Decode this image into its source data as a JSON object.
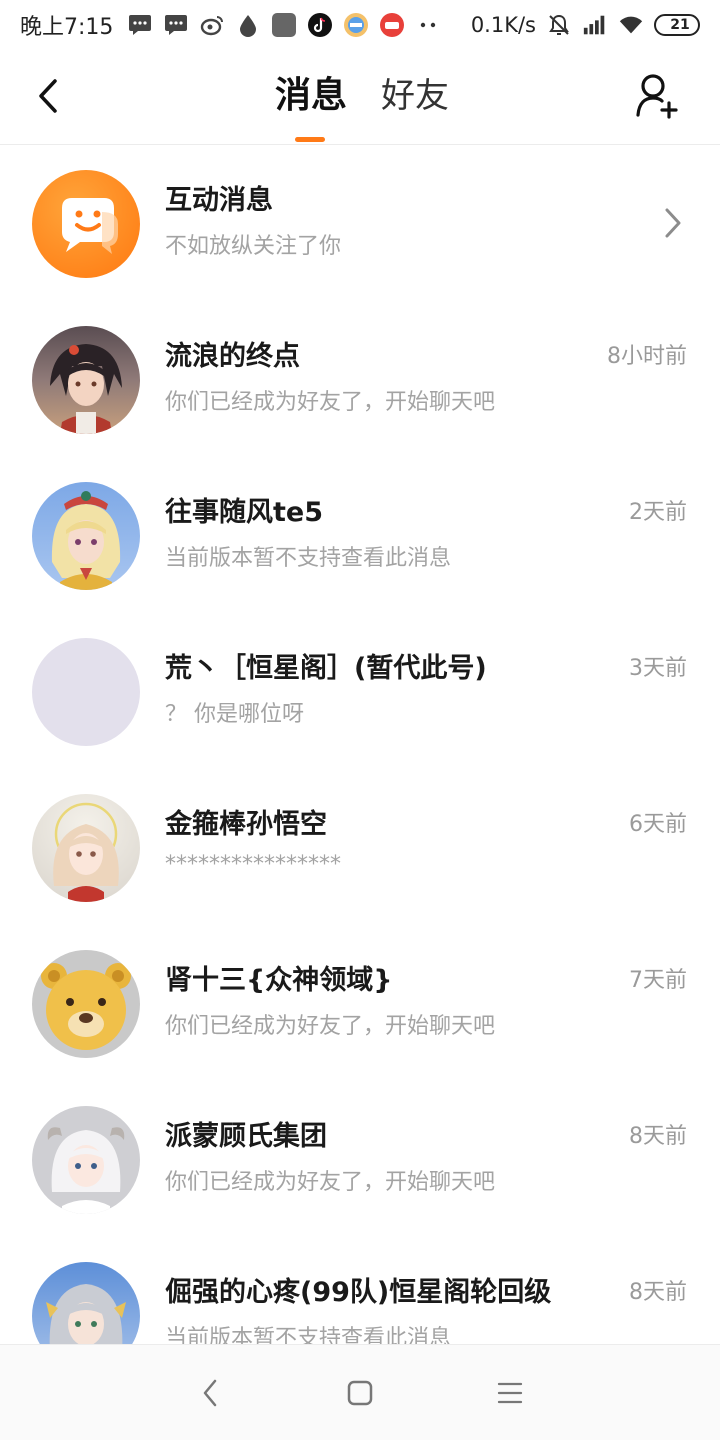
{
  "status_bar": {
    "time": "晚上7:15",
    "network_speed": "0.1K/s",
    "battery": "21",
    "icons": [
      "message-icon",
      "message-icon",
      "weibo-icon",
      "drop-icon",
      "app-icon",
      "tiktok-icon",
      "app-icon",
      "app-icon",
      "more-dots-icon",
      "mute-icon",
      "signal-icon",
      "wifi-icon",
      "battery-icon"
    ]
  },
  "header": {
    "tabs": [
      {
        "label": "消息",
        "active": true
      },
      {
        "label": "好友",
        "active": false
      }
    ],
    "accent": "#ff7a17"
  },
  "messages": [
    {
      "title": "互动消息",
      "subtitle": "不如放纵关注了你",
      "time": "",
      "avatar": "interaction-icon"
    },
    {
      "title": "流浪的终点",
      "subtitle": "你们已经成为好友了，开始聊天吧",
      "time": "8小时前",
      "avatar": "avatar"
    },
    {
      "title": "往事随风te5",
      "subtitle": "当前版本暂不支持查看此消息",
      "time": "2天前",
      "avatar": "avatar"
    },
    {
      "title": "荒丶［恒星阁］(暂代此号)",
      "subtitle": "？ 你是哪位呀",
      "time": "3天前",
      "avatar": "avatar"
    },
    {
      "title": "金箍棒孙悟空",
      "subtitle": "****************",
      "time": "6天前",
      "avatar": "avatar"
    },
    {
      "title": "肾十三{众神领域}",
      "subtitle": "你们已经成为好友了，开始聊天吧",
      "time": "7天前",
      "avatar": "avatar"
    },
    {
      "title": "派蒙顾氏集团",
      "subtitle": "你们已经成为好友了，开始聊天吧",
      "time": "8天前",
      "avatar": "avatar"
    },
    {
      "title": "倔强的心疼(99队)恒星阁轮回级",
      "subtitle": "当前版本暂不支持查看此消息",
      "time": "8天前",
      "avatar": "avatar"
    }
  ],
  "nav": [
    "back-nav-icon",
    "home-nav-icon",
    "menu-nav-icon"
  ]
}
